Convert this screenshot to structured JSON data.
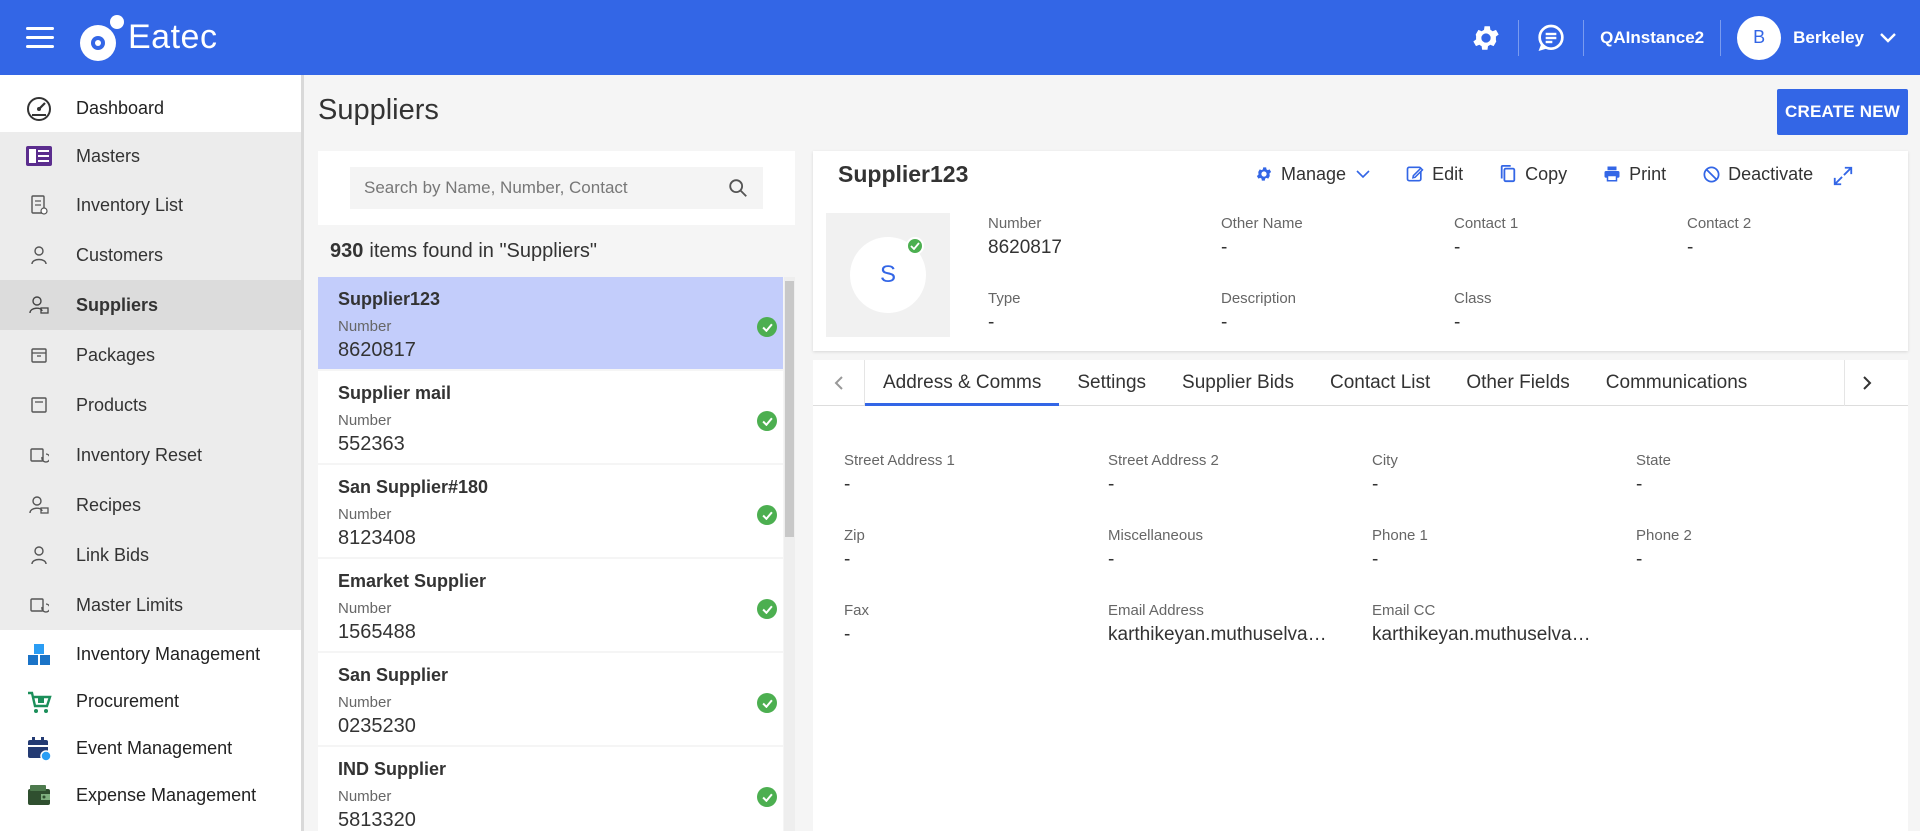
{
  "header": {
    "app_name": "Eatec",
    "instance": "QAInstance2",
    "user_initial": "B",
    "user_name": "Berkeley"
  },
  "sidebar": {
    "items": [
      {
        "label": "Dashboard",
        "icon": "gauge-icon",
        "kind": "top"
      },
      {
        "label": "Masters",
        "icon": "masters-icon",
        "kind": "masters"
      },
      {
        "label": "Inventory List",
        "icon": "inventory-list-icon",
        "kind": "sub"
      },
      {
        "label": "Customers",
        "icon": "customers-icon",
        "kind": "sub"
      },
      {
        "label": "Suppliers",
        "icon": "suppliers-icon",
        "kind": "active"
      },
      {
        "label": "Packages",
        "icon": "packages-icon",
        "kind": "sub"
      },
      {
        "label": "Products",
        "icon": "products-icon",
        "kind": "sub"
      },
      {
        "label": "Inventory Reset",
        "icon": "inventory-reset-icon",
        "kind": "sub"
      },
      {
        "label": "Recipes",
        "icon": "recipes-icon",
        "kind": "sub"
      },
      {
        "label": "Link Bids",
        "icon": "link-bids-icon",
        "kind": "sub"
      },
      {
        "label": "Master Limits",
        "icon": "master-limits-icon",
        "kind": "sub"
      },
      {
        "label": "Inventory Management",
        "icon": "inventory-management-icon",
        "kind": "top"
      },
      {
        "label": "Procurement",
        "icon": "cart-icon",
        "kind": "top"
      },
      {
        "label": "Event Management",
        "icon": "calendar-icon",
        "kind": "top"
      },
      {
        "label": "Expense Management",
        "icon": "wallet-icon",
        "kind": "top"
      }
    ]
  },
  "page": {
    "title": "Suppliers",
    "create_label": "CREATE NEW"
  },
  "search": {
    "placeholder": "Search by Name, Number, Contact",
    "value": ""
  },
  "results": {
    "count": "930",
    "text": "items found in \"Suppliers\""
  },
  "list": [
    {
      "name": "Supplier123",
      "label": "Number",
      "value": "8620817",
      "selected": true
    },
    {
      "name": "Supplier mail",
      "label": "Number",
      "value": "552363",
      "selected": false
    },
    {
      "name": "San Supplier#180",
      "label": "Number",
      "value": "8123408",
      "selected": false
    },
    {
      "name": "Emarket Supplier",
      "label": "Number",
      "value": "1565488",
      "selected": false
    },
    {
      "name": "San Supplier",
      "label": "Number",
      "value": "0235230",
      "selected": false
    },
    {
      "name": "IND Supplier",
      "label": "Number",
      "value": "5813320",
      "selected": false
    }
  ],
  "detail": {
    "title": "Supplier123",
    "avatar_initial": "S",
    "actions": {
      "manage": "Manage",
      "edit": "Edit",
      "copy": "Copy",
      "print": "Print",
      "deactivate": "Deactivate"
    },
    "fields": [
      {
        "label": "Number",
        "value": "8620817"
      },
      {
        "label": "Other Name",
        "value": "-"
      },
      {
        "label": "Contact 1",
        "value": "-"
      },
      {
        "label": "Contact 2",
        "value": "-"
      },
      {
        "label": "Type",
        "value": "-"
      },
      {
        "label": "Description",
        "value": "-"
      },
      {
        "label": "Class",
        "value": "-"
      }
    ]
  },
  "tabs": [
    {
      "label": "Address & Comms",
      "active": true
    },
    {
      "label": "Settings",
      "active": false
    },
    {
      "label": "Supplier Bids",
      "active": false
    },
    {
      "label": "Contact List",
      "active": false
    },
    {
      "label": "Other Fields",
      "active": false
    },
    {
      "label": "Communications",
      "active": false
    }
  ],
  "address": [
    {
      "label": "Street Address 1",
      "value": "-"
    },
    {
      "label": "Street Address 2",
      "value": "-"
    },
    {
      "label": "City",
      "value": "-"
    },
    {
      "label": "State",
      "value": "-"
    },
    {
      "label": "Zip",
      "value": "-"
    },
    {
      "label": "Miscellaneous",
      "value": "-"
    },
    {
      "label": "Phone 1",
      "value": "-"
    },
    {
      "label": "Phone 2",
      "value": "-"
    },
    {
      "label": "Fax",
      "value": "-"
    },
    {
      "label": "Email Address",
      "value": "karthikeyan.muthuselva…"
    },
    {
      "label": "Email CC",
      "value": "karthikeyan.muthuselva…"
    }
  ],
  "colors": {
    "brand": "#3366e6",
    "selected_row": "#c3cdfb",
    "status_ok": "#4caf50"
  }
}
